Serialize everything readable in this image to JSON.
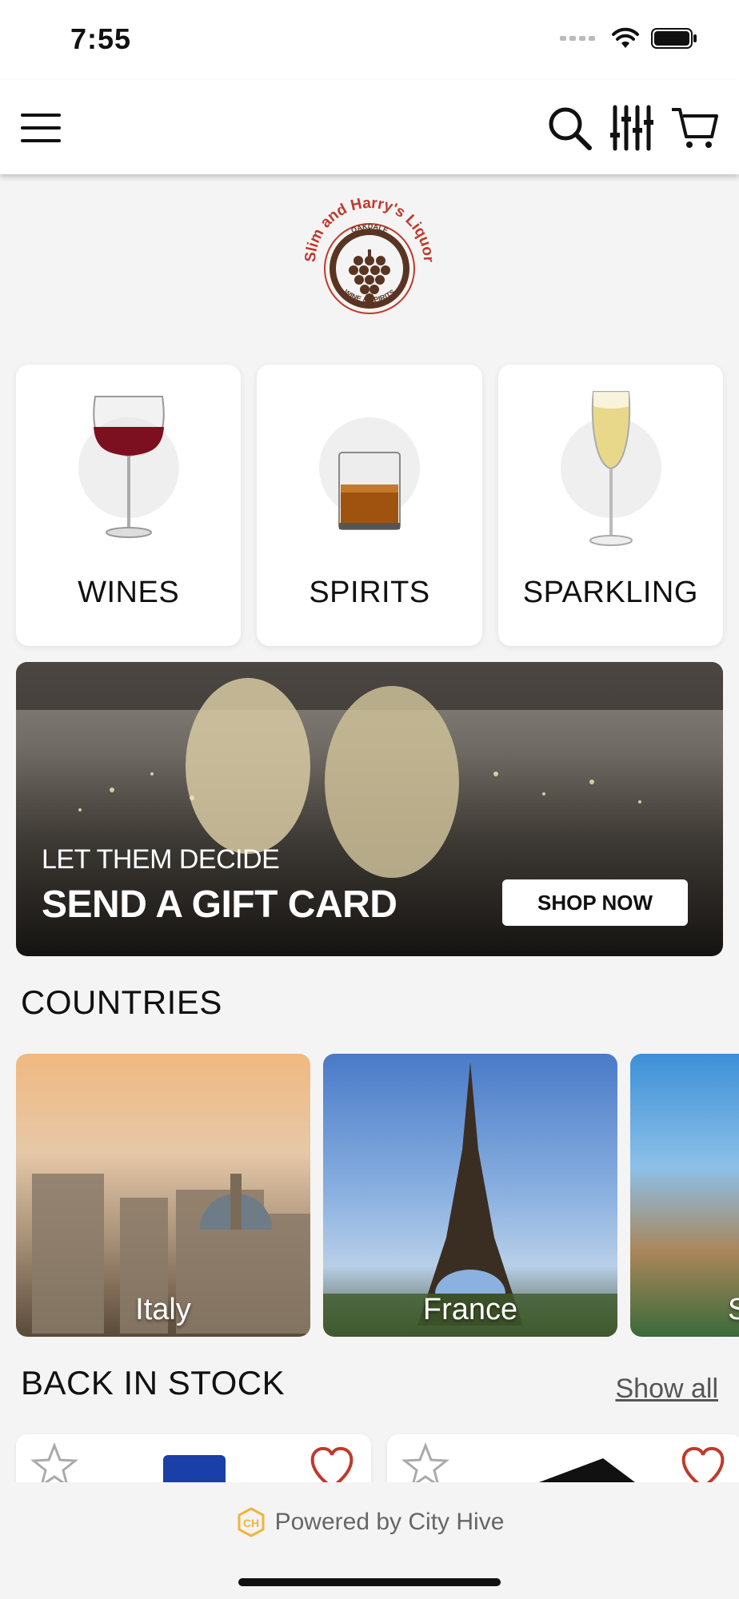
{
  "status_bar": {
    "time": "7:55"
  },
  "header": {
    "menu_icon": "hamburger-icon",
    "icons": [
      "search-icon",
      "filter-icon",
      "cart-icon"
    ]
  },
  "brand": {
    "logo_text": "Slim and Harry's Liquor",
    "logo_sub_top": "OAKDALE",
    "logo_sub_bottom": "WINE & SPIRITS",
    "logo_color": "#c0392b",
    "logo_dark": "#5a3422"
  },
  "categories": [
    {
      "label": "WINES",
      "icon": "wine-glass-icon"
    },
    {
      "label": "SPIRITS",
      "icon": "whiskey-glass-icon"
    },
    {
      "label": "SPARKLING",
      "icon": "champagne-flute-icon"
    }
  ],
  "banner": {
    "subtitle": "LET THEM DECIDE",
    "title": "SEND A GIFT CARD",
    "button_label": "SHOP NOW"
  },
  "countries": {
    "title": "COUNTRIES",
    "items": [
      {
        "name": "Italy"
      },
      {
        "name": "France"
      },
      {
        "name": "S"
      }
    ]
  },
  "back_in_stock": {
    "title": "BACK IN STOCK",
    "show_all_label": "Show all"
  },
  "footer": {
    "powered_by": "Powered by City Hive"
  }
}
